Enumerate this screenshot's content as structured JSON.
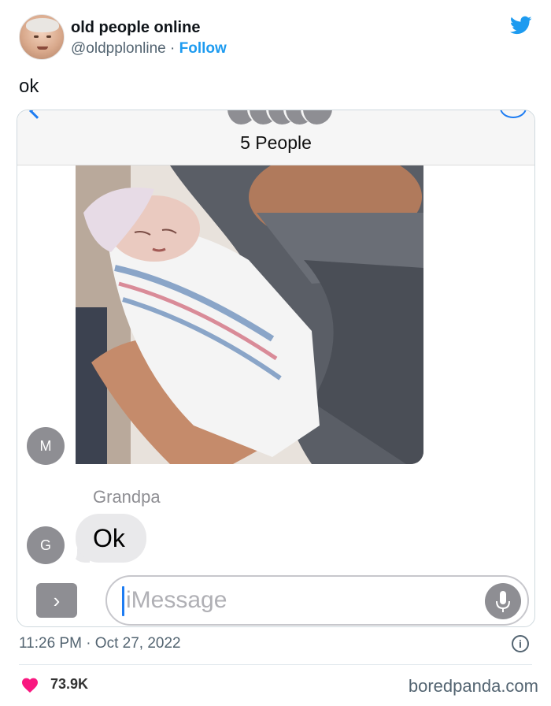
{
  "tweet": {
    "author_name": "old people online",
    "author_handle": "@oldpplonline",
    "separator": " · ",
    "follow_label": "Follow",
    "text": "ok",
    "timestamp": "11:26 PM · Oct 27, 2022",
    "likes": "73.9K",
    "info_icon": "i"
  },
  "imessage": {
    "group_title": "5 People",
    "contacts": [
      {
        "initial": "M"
      },
      {
        "initial": "G"
      }
    ],
    "sender_label": "Grandpa",
    "message": "Ok",
    "input_placeholder": "iMessage",
    "apps_button_glyph": "›"
  },
  "watermark": "boredpanda.com",
  "colors": {
    "twitter_blue": "#1d9bf0",
    "imessage_blue": "#1d7cf2",
    "bubble_gray": "#e9e9eb",
    "heart_pink": "#f91880"
  },
  "icons": [
    "twitter-bird-icon",
    "chevron-right-icon",
    "microphone-icon",
    "info-icon",
    "heart-icon",
    "back-chevron-icon"
  ]
}
